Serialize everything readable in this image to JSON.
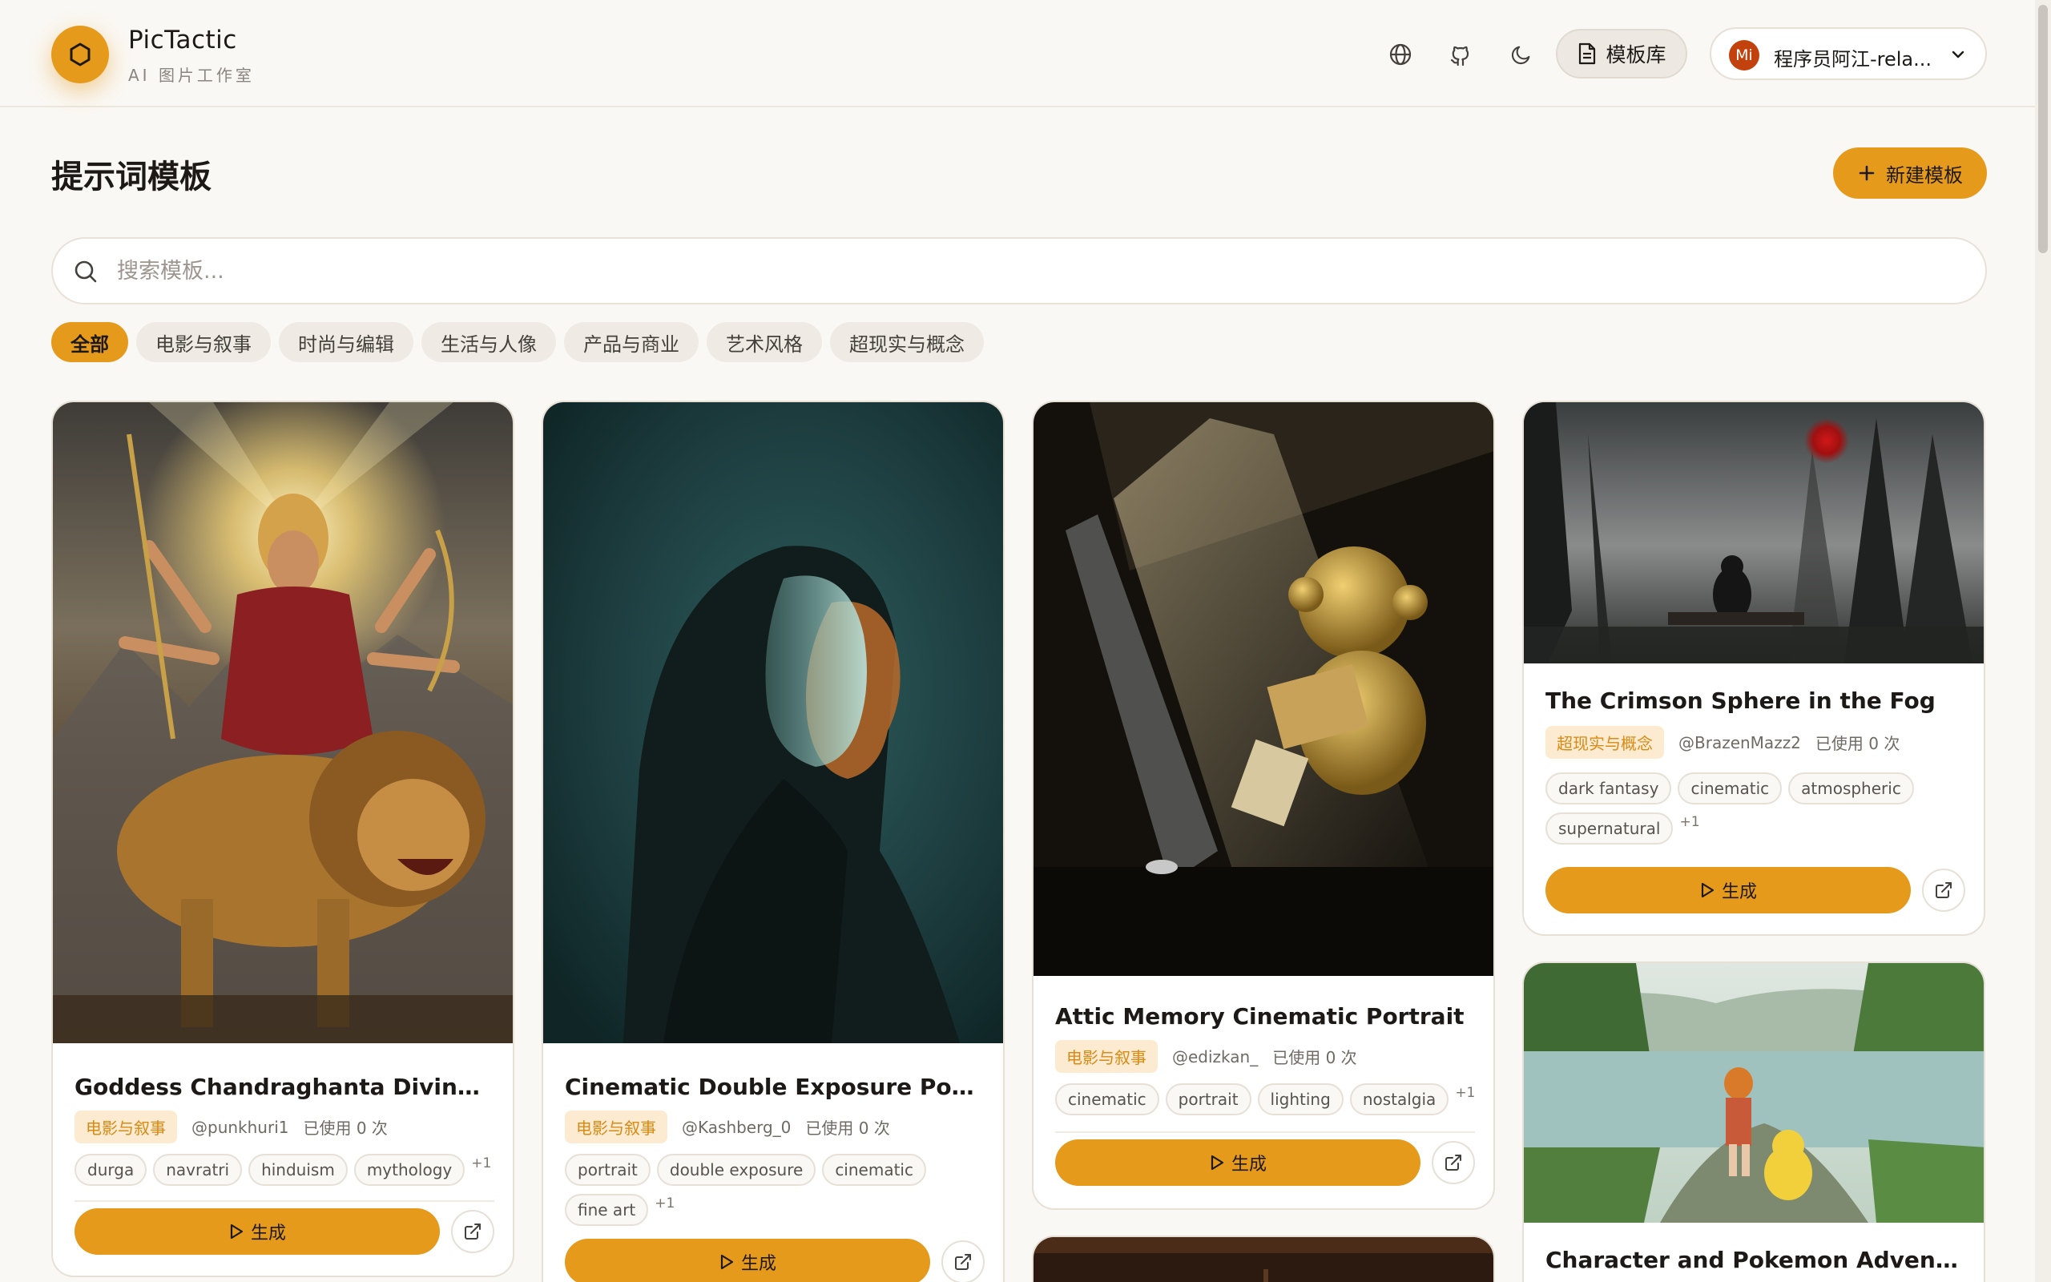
{
  "app": {
    "name": "PicTactic",
    "subtitle": "AI 图片工作室"
  },
  "header": {
    "icons": [
      "globe-icon",
      "github-icon",
      "moon-icon"
    ],
    "library_label": "模板库",
    "user": {
      "initials": "Mi",
      "name": "程序员阿江-rela..."
    }
  },
  "page": {
    "title": "提示词模板",
    "new_button": "新建模板"
  },
  "search": {
    "placeholder": "搜索模板..."
  },
  "categories": [
    "全部",
    "电影与叙事",
    "时尚与编辑",
    "生活与人像",
    "产品与商业",
    "艺术风格",
    "超现实与概念"
  ],
  "active_category": "全部",
  "generate_label": "生成",
  "colors": {
    "accent": "#e69a1c",
    "badge_bg": "#fcebd0",
    "badge_text": "#d98a14"
  },
  "cards": [
    {
      "title": "Goddess Chandraghanta Divine Portr...",
      "category": "电影与叙事",
      "author": "@punkhuri1",
      "usage": "已使用 0 次",
      "tags": [
        "durga",
        "navratri",
        "hinduism",
        "mythology"
      ],
      "more": "+1"
    },
    {
      "title": "Cinematic Double Exposure Portrait",
      "category": "电影与叙事",
      "author": "@Kashberg_0",
      "usage": "已使用 0 次",
      "tags": [
        "portrait",
        "double exposure",
        "cinematic",
        "fine art"
      ],
      "more": "+1"
    },
    {
      "title": "Attic Memory Cinematic Portrait",
      "category": "电影与叙事",
      "author": "@edizkan_",
      "usage": "已使用 0 次",
      "tags": [
        "cinematic",
        "portrait",
        "lighting",
        "nostalgia"
      ],
      "more": "+1"
    },
    {
      "title": "The Crimson Sphere in the Fog",
      "category": "超现实与概念",
      "author": "@BrazenMazz2",
      "usage": "已使用 0 次",
      "tags": [
        "dark fantasy",
        "cinematic",
        "atmospheric",
        "supernatural"
      ],
      "more": "+1"
    },
    {
      "title": "Character and Pokemon Adventure"
    }
  ]
}
